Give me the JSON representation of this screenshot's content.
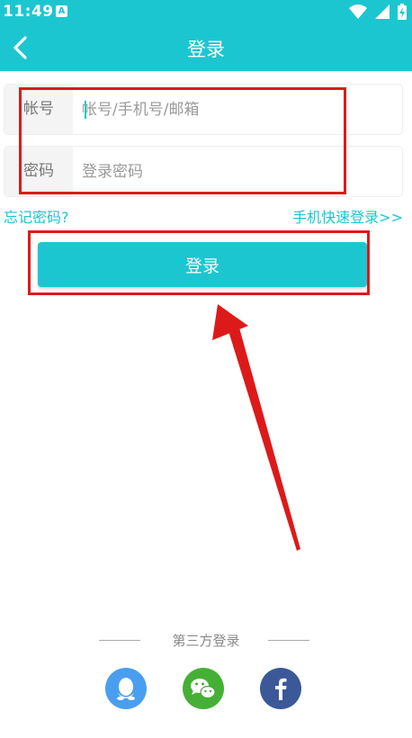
{
  "status_bar": {
    "time": "11:49",
    "notification_icon": "A"
  },
  "header": {
    "title": "登录",
    "back_icon": "chevron-left-icon"
  },
  "form": {
    "account": {
      "label": "帐号",
      "placeholder": "帐号/手机号/邮箱"
    },
    "password": {
      "label": "密码",
      "placeholder": "登录密码"
    }
  },
  "links": {
    "forgot_password": "忘记密码?",
    "phone_quick_login": "手机快速登录>>"
  },
  "login_button": "登录",
  "third_party": {
    "label": "第三方登录",
    "providers": [
      "qq-icon",
      "wechat-icon",
      "facebook-icon"
    ]
  },
  "colors": {
    "accent": "#1cc6d0",
    "annotation": "#dd1a1a",
    "qq": "#4a9ef0",
    "wechat": "#45b035",
    "facebook": "#3b5998"
  }
}
